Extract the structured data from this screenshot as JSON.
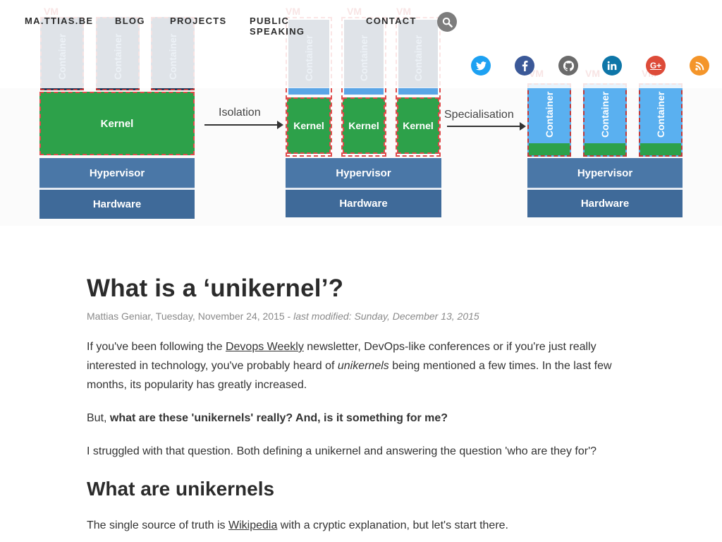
{
  "hero": {
    "labels": {
      "hardware": "Hardware",
      "hypervisor": "Hypervisor",
      "kernel": "Kernel",
      "container": "Container",
      "vm": "VM",
      "isolation": "Isolation",
      "specialisation": "Specialisation"
    }
  },
  "nav": {
    "brand": "MA.TTIAS.BE",
    "items": [
      "BLOG",
      "PROJECTS",
      "PUBLIC SPEAKING",
      "CONTACT"
    ],
    "search_icon": "search-icon"
  },
  "social": [
    {
      "name": "twitter-icon",
      "glyph": "t",
      "color": "#1da1f2"
    },
    {
      "name": "facebook-icon",
      "glyph": "f",
      "color": "#3b5998"
    },
    {
      "name": "github-icon",
      "glyph": "◉",
      "color": "#6b6b6b"
    },
    {
      "name": "linkedin-icon",
      "glyph": "in",
      "color": "#0e76a8"
    },
    {
      "name": "google-plus-icon",
      "glyph": "G+",
      "color": "#dd4b39"
    },
    {
      "name": "rss-icon",
      "glyph": "◔",
      "color": "#f4952a"
    }
  ],
  "article": {
    "title": "What is a ‘unikernel’?",
    "author_date": "Mattias Geniar, Tuesday, November 24, 2015",
    "separator": " - ",
    "last_modified": "last modified: Sunday, December 13, 2015",
    "p1_before": "If you've been following the ",
    "p1_link": "Devops Weekly",
    "p1_mid": " newsletter, DevOps-like conferences or if you're just really interested in technology, you've probably heard of ",
    "p1_em": "unikernels",
    "p1_after": " being mentioned a few times. In the last few months, its popularity has greatly increased.",
    "p2_before": "But, ",
    "p2_strong": "what are these 'unikernels' really? And, is it something for me?",
    "p3": "I struggled with that question. Both defining a unikernel and answering the question 'who are they for'?",
    "h2": "What are unikernels",
    "p4_before": "The single source of truth is ",
    "p4_link": "Wikipedia",
    "p4_after": " with a cryptic explanation, but let's start there."
  }
}
